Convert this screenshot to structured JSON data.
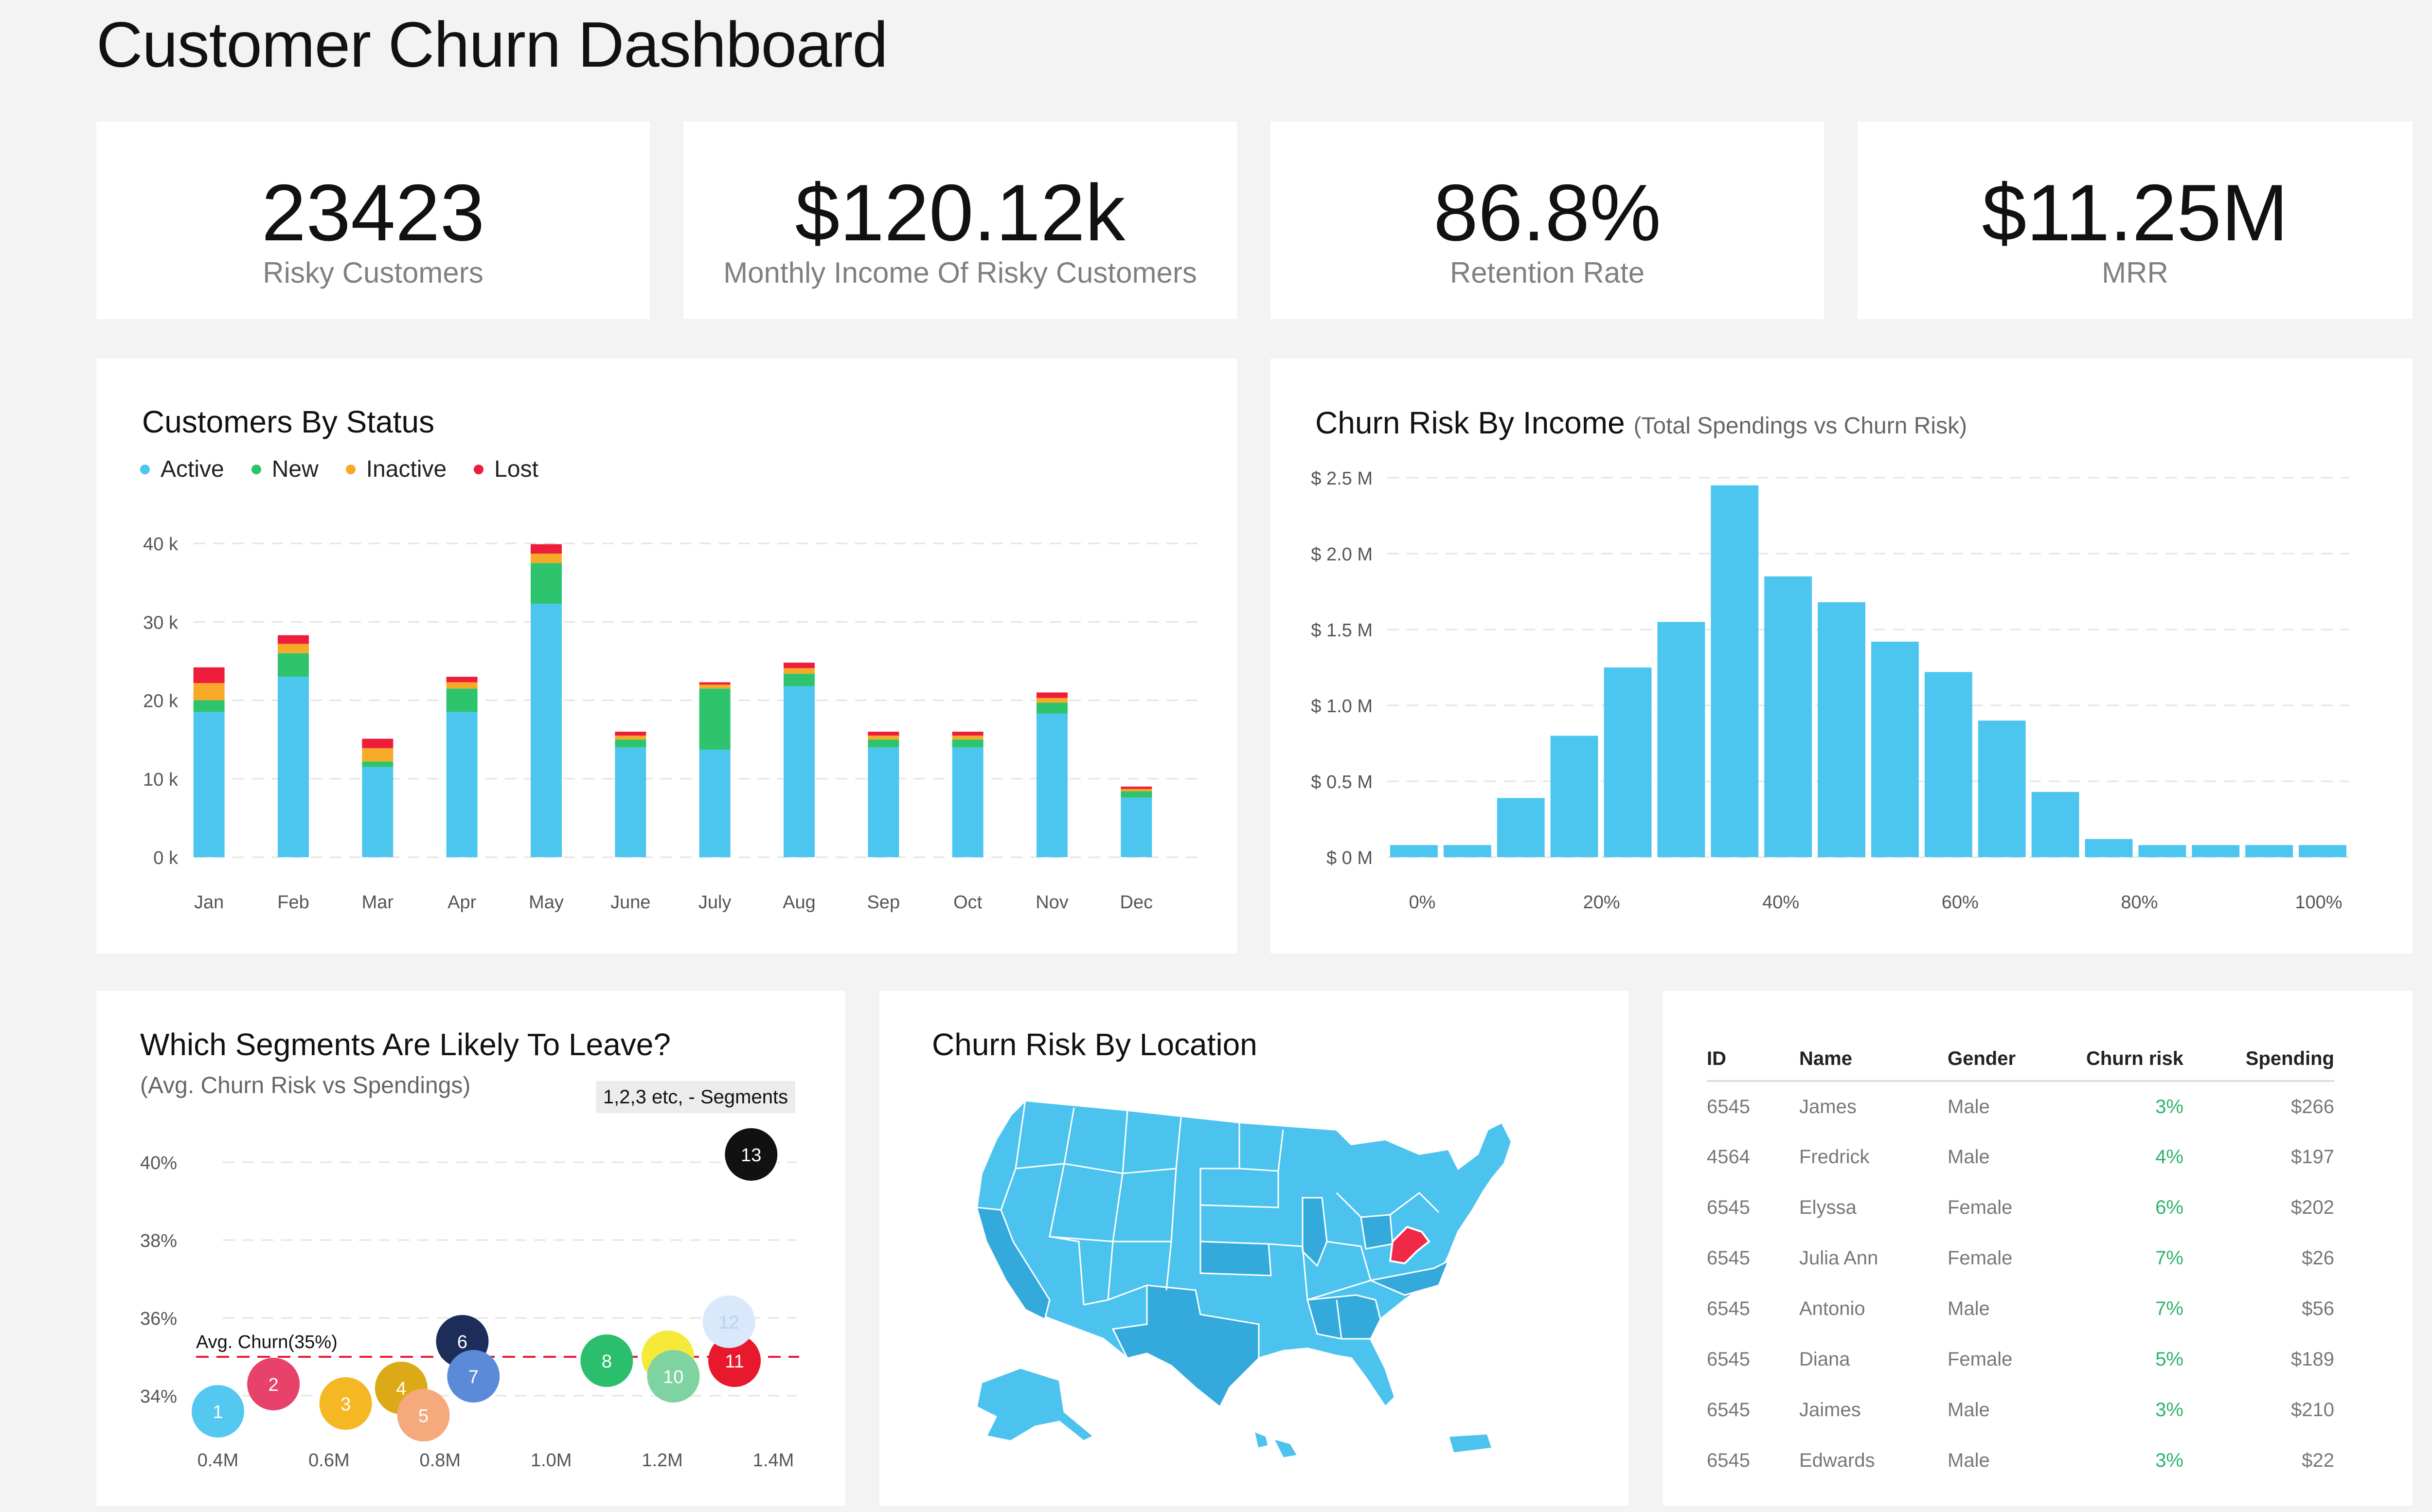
{
  "title": "Customer Churn Dashboard",
  "kpis": [
    {
      "value": "23423",
      "label": "Risky Customers"
    },
    {
      "value": "$120.12k",
      "label": "Monthly Income Of Risky Customers"
    },
    {
      "value": "86.8%",
      "label": "Retention Rate"
    },
    {
      "value": "$11.25M",
      "label": "MRR"
    }
  ],
  "status_card": {
    "title": "Customers By Status",
    "legend": [
      "Active",
      "New",
      "Inactive",
      "Lost"
    ]
  },
  "income_card": {
    "title": "Churn Risk By Income",
    "subtitle": "(Total Spendings vs Churn Risk)"
  },
  "segments_card": {
    "title": "Which Segments Are Likely To Leave?",
    "subtitle": "(Avg. Churn Risk vs Spendings)",
    "tag": "1,2,3 etc, - Segments",
    "avg_label": "Avg. Churn(35%)"
  },
  "location_card": {
    "title": "Churn Risk By Location"
  },
  "customers_table": {
    "headers": [
      "ID",
      "Name",
      "Gender",
      "Churn risk",
      "Spending"
    ],
    "rows": [
      [
        "6545",
        "James",
        "Male",
        "3%",
        "$266"
      ],
      [
        "4564",
        "Fredrick",
        "Male",
        "4%",
        "$197"
      ],
      [
        "6545",
        "Elyssa",
        "Female",
        "6%",
        "$202"
      ],
      [
        "6545",
        "Julia Ann",
        "Female",
        "7%",
        "$26"
      ],
      [
        "6545",
        "Antonio",
        "Male",
        "7%",
        "$56"
      ],
      [
        "6545",
        "Diana",
        "Female",
        "5%",
        "$189"
      ],
      [
        "6545",
        "Jaimes",
        "Male",
        "3%",
        "$210"
      ],
      [
        "6545",
        "Edwards",
        "Male",
        "3%",
        "$22"
      ]
    ]
  },
  "colors": {
    "active": "#4dc6ef",
    "new": "#2ec46d",
    "inactive": "#f7a928",
    "lost": "#ee1d3c",
    "highlight_state": "#ee2a46",
    "map": "#4cc3ee",
    "map_dark": "#33aadb"
  },
  "chart_data": [
    {
      "type": "bar",
      "stacked": true,
      "title": "Customers By Status",
      "categories": [
        "Jan",
        "Feb",
        "Mar",
        "Apr",
        "May",
        "June",
        "July",
        "Aug",
        "Sep",
        "Oct",
        "Nov",
        "Dec"
      ],
      "series": [
        {
          "name": "Active",
          "values": [
            18500,
            23000,
            11500,
            18500,
            32300,
            14000,
            13700,
            21800,
            14000,
            14000,
            18300,
            7600
          ]
        },
        {
          "name": "New",
          "values": [
            1500,
            3000,
            700,
            3000,
            5200,
            1000,
            7800,
            1600,
            1000,
            1000,
            1400,
            800
          ]
        },
        {
          "name": "Inactive",
          "values": [
            2200,
            1200,
            1700,
            800,
            1200,
            500,
            500,
            700,
            500,
            500,
            600,
            300
          ]
        },
        {
          "name": "Lost",
          "values": [
            2000,
            1100,
            1200,
            700,
            1200,
            500,
            300,
            700,
            500,
            500,
            700,
            300
          ]
        }
      ],
      "yticks": [
        "0 k",
        "10 k",
        "20 k",
        "30 k",
        "40 k"
      ],
      "ylim": [
        0,
        40000
      ],
      "legend": "top-left"
    },
    {
      "type": "bar",
      "title": "Churn Risk By Income",
      "subtitle": "(Total Spendings vs Churn Risk)",
      "x": [
        0,
        5,
        10,
        15,
        20,
        25,
        30,
        35,
        40,
        45,
        50,
        55,
        60,
        65,
        70,
        75,
        80,
        85,
        90,
        95,
        100
      ],
      "values": [
        0.08,
        0.08,
        0.39,
        0.8,
        1.25,
        1.55,
        2.45,
        1.85,
        1.68,
        1.42,
        1.22,
        0.9,
        0.43,
        0.12,
        0.08,
        0.08,
        0.08,
        0.08
      ],
      "xticks": [
        "0%",
        "20%",
        "40%",
        "60%",
        "80%",
        "100%"
      ],
      "yticks": [
        "$ 0 M",
        "$ 0.5 M",
        "$ 1.0 M",
        "$ 1.5 M",
        "$ 2.0 M",
        "$ 2.5 M"
      ],
      "ylim": [
        0,
        2.5
      ]
    },
    {
      "type": "scatter",
      "title": "Which Segments Are Likely To Leave?",
      "subtitle": "(Avg. Churn Risk vs Spendings)",
      "points": [
        {
          "label": "1",
          "x": 0.4,
          "y": 33.6,
          "color": "#54c8f0"
        },
        {
          "label": "2",
          "x": 0.5,
          "y": 34.3,
          "color": "#e8416a"
        },
        {
          "label": "3",
          "x": 0.63,
          "y": 33.8,
          "color": "#f5b724"
        },
        {
          "label": "4",
          "x": 0.73,
          "y": 34.2,
          "color": "#dcaa16"
        },
        {
          "label": "5",
          "x": 0.77,
          "y": 33.5,
          "color": "#f6a97c"
        },
        {
          "label": "6",
          "x": 0.84,
          "y": 35.4,
          "color": "#1c2d5a"
        },
        {
          "label": "7",
          "x": 0.86,
          "y": 34.5,
          "color": "#5b8bd8"
        },
        {
          "label": "8",
          "x": 1.1,
          "y": 34.9,
          "color": "#2bbf6d"
        },
        {
          "label": "9",
          "x": 1.21,
          "y": 35.0,
          "color": "#f5ea3a"
        },
        {
          "label": "10",
          "x": 1.22,
          "y": 34.5,
          "color": "#7fd3a0"
        },
        {
          "label": "11",
          "x": 1.33,
          "y": 34.9,
          "color": "#e8192c"
        },
        {
          "label": "12",
          "x": 1.32,
          "y": 35.9,
          "color": "#d9e8fb"
        },
        {
          "label": "13",
          "x": 1.36,
          "y": 40.2,
          "color": "#111111"
        }
      ],
      "avg_line": 35,
      "xticks": [
        "0.4M",
        "0.6M",
        "0.8M",
        "1.0M",
        "1.2M",
        "1.4M"
      ],
      "yticks": [
        "34%",
        "36%",
        "38%",
        "40%"
      ],
      "xlim": [
        0.4,
        1.4
      ],
      "ylim": [
        34,
        40
      ]
    }
  ]
}
